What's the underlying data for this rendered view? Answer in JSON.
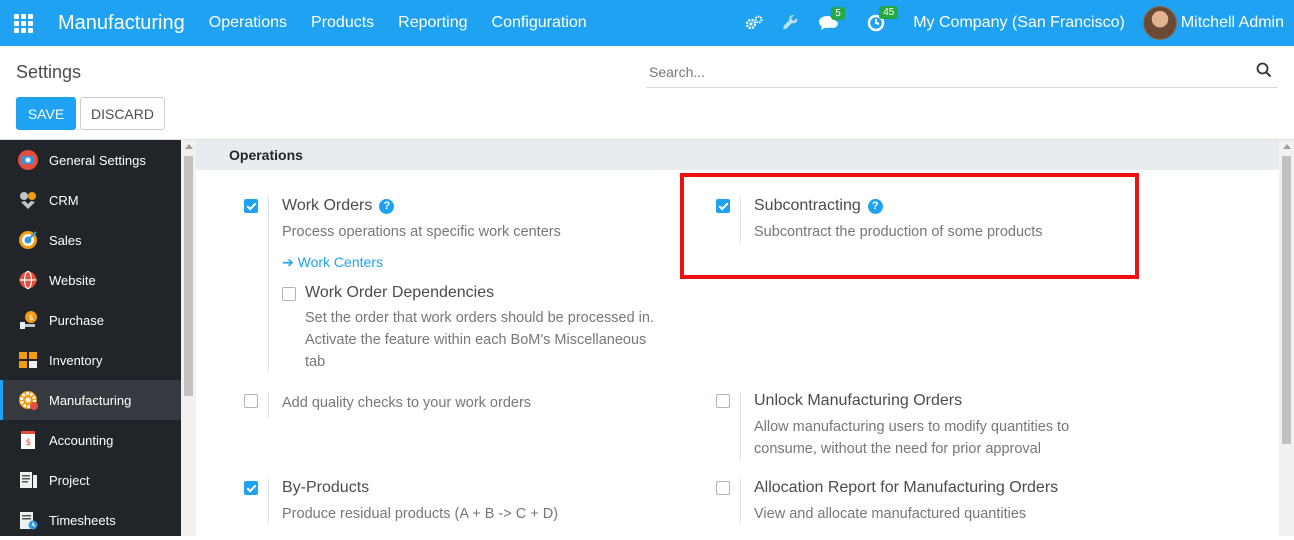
{
  "navbar": {
    "brand": "Manufacturing",
    "menu": [
      "Operations",
      "Products",
      "Reporting",
      "Configuration"
    ],
    "messages_count": "5",
    "activities_count": "45",
    "company": "My Company (San Francisco)",
    "user": "Mitchell Admin"
  },
  "control": {
    "title": "Settings",
    "search_placeholder": "Search...",
    "save_label": "SAVE",
    "discard_label": "DISCARD"
  },
  "sidebar": {
    "items": [
      {
        "label": "General Settings",
        "icon": "general-settings-icon",
        "color": "#e74c3c"
      },
      {
        "label": "CRM",
        "icon": "crm-icon",
        "color": "#9aa0a6"
      },
      {
        "label": "Sales",
        "icon": "sales-icon",
        "color": "#f39c12"
      },
      {
        "label": "Website",
        "icon": "website-icon",
        "color": "#e74c3c"
      },
      {
        "label": "Purchase",
        "icon": "purchase-icon",
        "color": "#f39c12"
      },
      {
        "label": "Inventory",
        "icon": "inventory-icon",
        "color": "#f39c12"
      },
      {
        "label": "Manufacturing",
        "icon": "manufacturing-icon",
        "color": "#f39c12"
      },
      {
        "label": "Accounting",
        "icon": "accounting-icon",
        "color": "#e74c3c"
      },
      {
        "label": "Project",
        "icon": "project-icon",
        "color": "#ffffff"
      },
      {
        "label": "Timesheets",
        "icon": "timesheets-icon",
        "color": "#3498db"
      }
    ],
    "active": "Manufacturing"
  },
  "section": {
    "title": "Operations"
  },
  "settings": {
    "work_orders": {
      "title": "Work Orders",
      "desc": "Process operations at specific work centers",
      "checked": true,
      "link": "Work Centers"
    },
    "wo_dependencies": {
      "title": "Work Order Dependencies",
      "desc1": "Set the order that work orders should be processed in.",
      "desc2": "Activate the feature within each BoM's Miscellaneous",
      "desc3": "tab",
      "checked": false
    },
    "subcontracting": {
      "title": "Subcontracting",
      "desc": "Subcontract the production of some products",
      "checked": true
    },
    "quality": {
      "desc": "Add quality checks to your work orders",
      "checked": false
    },
    "unlock": {
      "title": "Unlock Manufacturing Orders",
      "desc1": "Allow manufacturing users to modify quantities to",
      "desc2": "consume, without the need for prior approval",
      "checked": false
    },
    "by_products": {
      "title": "By-Products",
      "desc": "Produce residual products (A + B -> C + D)",
      "checked": true
    },
    "allocation": {
      "title": "Allocation Report for Manufacturing Orders",
      "desc": "View and allocate manufactured quantities",
      "checked": false
    }
  },
  "colors": {
    "accent": "#1ea2f1",
    "highlight": "#ee1111",
    "sidebar_bg": "#212529"
  }
}
